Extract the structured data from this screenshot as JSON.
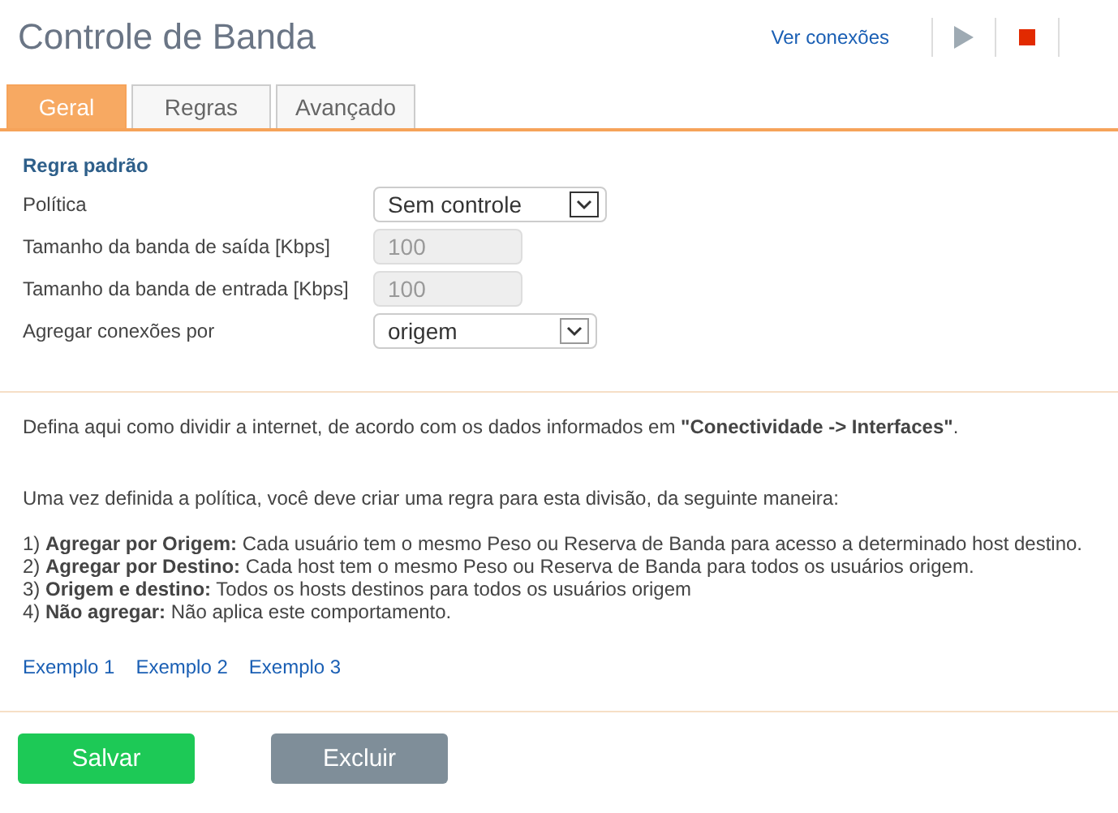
{
  "header": {
    "title": "Controle de Banda",
    "link": "Ver conexões"
  },
  "tabs": [
    {
      "label": "Geral",
      "selected": true
    },
    {
      "label": "Regras",
      "selected": false
    },
    {
      "label": "Avançado",
      "selected": false
    }
  ],
  "section_title": "Regra padrão",
  "fields": [
    {
      "label": "Política",
      "kind": "select",
      "value": "Sem controle",
      "disabled": false
    },
    {
      "label": "Tamanho da banda de saída [Kbps]",
      "kind": "input",
      "value": "100",
      "disabled": true
    },
    {
      "label": "Tamanho da banda de entrada [Kbps]",
      "kind": "input",
      "value": "100",
      "disabled": true
    },
    {
      "label": "Agregar conexões por",
      "kind": "select",
      "value": "origem",
      "disabled": false
    }
  ],
  "intro": "Defina aqui como dividir a internet, de acordo com os dados informados em **\"Conectividade -> Interfaces\"**.",
  "instructions": "Uma vez definida a política, você deve criar uma regra para esta divisão, da seguinte maneira:",
  "options": [
    "1) **Agregar por Origem:** Cada usuário tem o mesmo Peso ou Reserva de Banda para acesso a determinado host destino.",
    "2) **Agregar por Destino:** Cada host tem o mesmo Peso ou Reserva de Banda para todos os usuários origem.",
    "3) **Origem e destino:** Todos os hosts destinos para todos os usuários origem",
    "4) **Não agregar:** Não aplica este comportamento."
  ],
  "examples": [
    "Exemplo 1",
    "Exemplo 2",
    "Exemplo 3"
  ],
  "buttons": [
    {
      "label": "Salvar",
      "kind": "primary"
    },
    {
      "label": "Excluir",
      "kind": "secondary"
    }
  ]
}
